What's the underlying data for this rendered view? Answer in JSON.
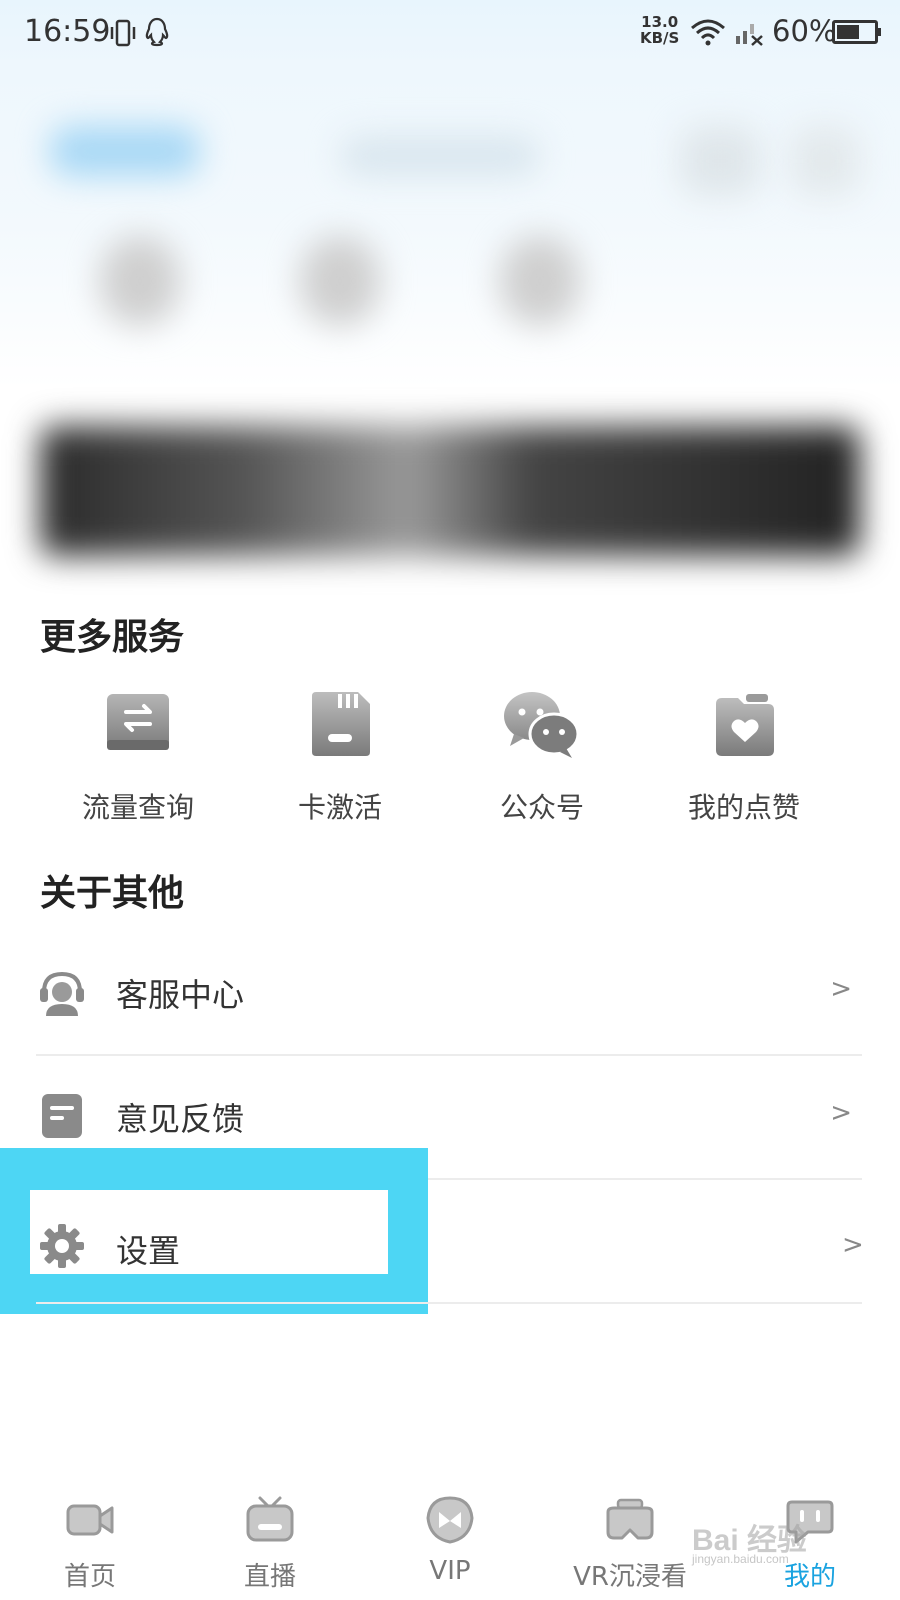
{
  "status_bar": {
    "time": "16:59",
    "net_speed_value": "13.0",
    "net_speed_unit": "KB/S",
    "battery_text": "60%",
    "battery_level": 0.6,
    "icons": [
      "vibrate-icon",
      "qq-icon",
      "wifi-icon",
      "signal-icon",
      "battery-icon"
    ]
  },
  "more_services": {
    "title": "更多服务",
    "items": [
      {
        "label": "流量查询",
        "icon": "data-usage-icon"
      },
      {
        "label": "卡激活",
        "icon": "sim-card-icon"
      },
      {
        "label": "公众号",
        "icon": "wechat-icon"
      },
      {
        "label": "我的点赞",
        "icon": "likes-folder-icon"
      }
    ]
  },
  "about_others": {
    "title": "关于其他",
    "items": [
      {
        "label": "客服中心",
        "icon": "customer-service-icon"
      },
      {
        "label": "意见反馈",
        "icon": "feedback-icon"
      },
      {
        "label": "设置",
        "icon": "gear-icon"
      }
    ]
  },
  "bottom_nav": {
    "items": [
      {
        "label": "首页",
        "icon": "video-camera-icon",
        "active": false
      },
      {
        "label": "直播",
        "icon": "tv-icon",
        "active": false
      },
      {
        "label": "VIP",
        "icon": "vip-diamond-icon",
        "active": false
      },
      {
        "label": "VR沉浸看",
        "icon": "vr-headset-icon",
        "active": false
      },
      {
        "label": "我的",
        "icon": "profile-chat-icon",
        "active": true
      }
    ]
  },
  "colors": {
    "highlight": "#4dd6f4",
    "active_tab": "#1aa3e0",
    "icon_gray": "#8a8a8a"
  },
  "watermark": {
    "text": "Bai 经验",
    "sub": "jingyan.baidu.com"
  }
}
